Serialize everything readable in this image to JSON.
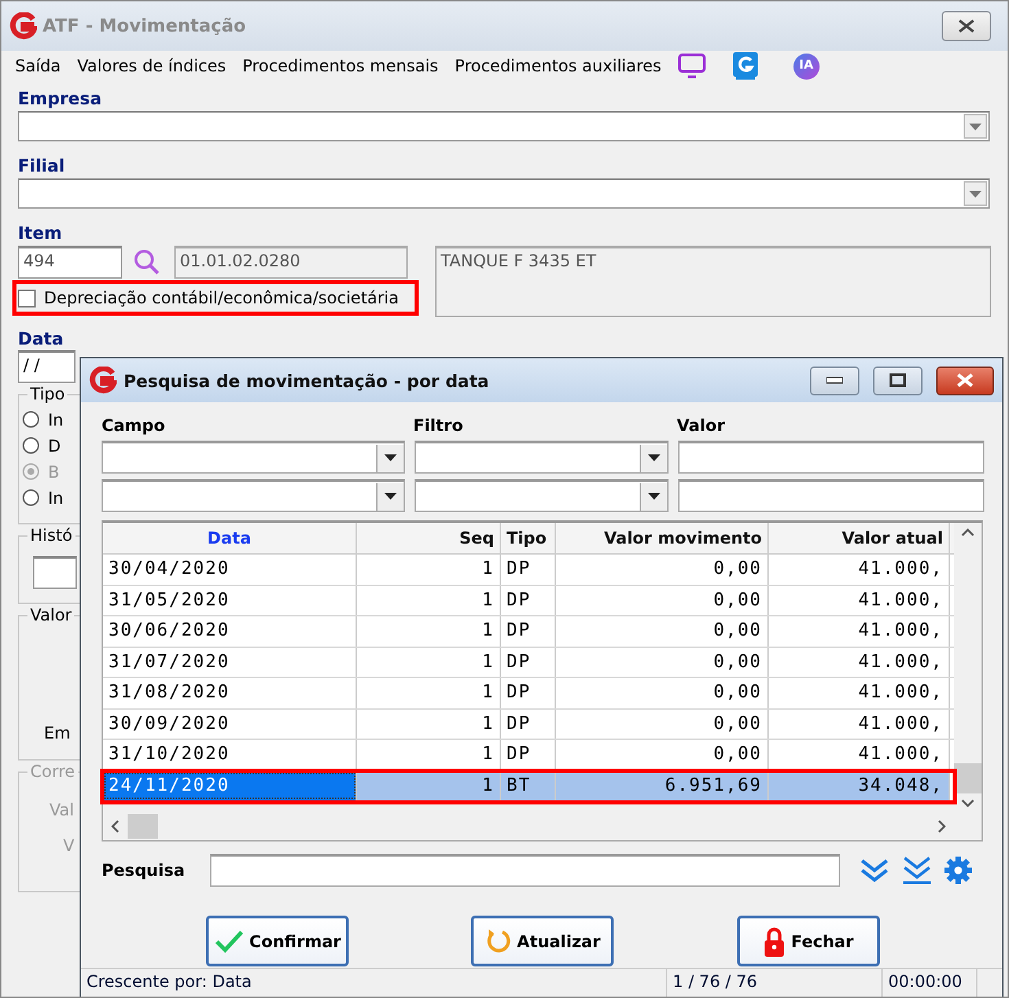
{
  "window": {
    "title": "ATF - Movimentação"
  },
  "menu": [
    {
      "label": "Saída"
    },
    {
      "label": "Valores de índices"
    },
    {
      "label": "Procedimentos mensais"
    },
    {
      "label": "Procedimentos auxiliares"
    }
  ],
  "toolbar": {
    "badge": "IA"
  },
  "empresa": {
    "label": "Empresa"
  },
  "filial": {
    "label": "Filial"
  },
  "item": {
    "label": "Item",
    "code": "494",
    "account": "01.01.02.0280",
    "description": "TANQUE F 3435 ET"
  },
  "depreciation_checkbox": {
    "label": "Depreciação contábil/econômica/societária",
    "checked": false,
    "highlighted": true
  },
  "data": {
    "label": "Data",
    "value": "/ /"
  },
  "tipo": {
    "label": "Tipo",
    "options": [
      {
        "label": "In",
        "selected": false,
        "disabled": false
      },
      {
        "label": "D",
        "selected": false,
        "disabled": false
      },
      {
        "label": "B",
        "selected": true,
        "disabled": true
      },
      {
        "label": "In",
        "selected": false,
        "disabled": false
      }
    ]
  },
  "historico": {
    "label": "Histó"
  },
  "valor": {
    "label": "Valor",
    "text": "Em"
  },
  "correcao": {
    "label": "Corre",
    "disabled": true,
    "texts": [
      "Val",
      "V"
    ]
  },
  "dialog": {
    "title": "Pesquisa de movimentação - por data",
    "filter_labels": [
      "Campo",
      "Filtro",
      "Valor"
    ],
    "table": {
      "columns": [
        {
          "label": "Data",
          "sorted": true
        },
        {
          "label": "Seq",
          "sorted": false
        },
        {
          "label": "Tipo",
          "sorted": false
        },
        {
          "label": "Valor movimento",
          "sorted": false
        },
        {
          "label": "Valor atual",
          "sorted": false
        }
      ],
      "rows": [
        {
          "cells": [
            "30/04/2020",
            "1",
            "DP",
            "0,00",
            "41.000,"
          ],
          "selected": false,
          "highlighted": false
        },
        {
          "cells": [
            "31/05/2020",
            "1",
            "DP",
            "0,00",
            "41.000,"
          ],
          "selected": false,
          "highlighted": false
        },
        {
          "cells": [
            "30/06/2020",
            "1",
            "DP",
            "0,00",
            "41.000,"
          ],
          "selected": false,
          "highlighted": false
        },
        {
          "cells": [
            "31/07/2020",
            "1",
            "DP",
            "0,00",
            "41.000,"
          ],
          "selected": false,
          "highlighted": false
        },
        {
          "cells": [
            "31/08/2020",
            "1",
            "DP",
            "0,00",
            "41.000,"
          ],
          "selected": false,
          "highlighted": false
        },
        {
          "cells": [
            "30/09/2020",
            "1",
            "DP",
            "0,00",
            "41.000,"
          ],
          "selected": false,
          "highlighted": false
        },
        {
          "cells": [
            "31/10/2020",
            "1",
            "DP",
            "0,00",
            "41.000,"
          ],
          "selected": false,
          "highlighted": false
        },
        {
          "cells": [
            "24/11/2020",
            "1",
            "BT",
            "6.951,69",
            "34.048,"
          ],
          "selected": true,
          "highlighted": true
        }
      ]
    },
    "search": {
      "label": "Pesquisa"
    },
    "buttons": [
      {
        "label": "Confirmar",
        "kind": "confirm"
      },
      {
        "label": "Atualizar",
        "kind": "refresh"
      },
      {
        "label": "Fechar",
        "kind": "close"
      }
    ],
    "status_bar": [
      "Crescente por: Data",
      "1 / 76 / 76",
      "00:00:00"
    ]
  }
}
